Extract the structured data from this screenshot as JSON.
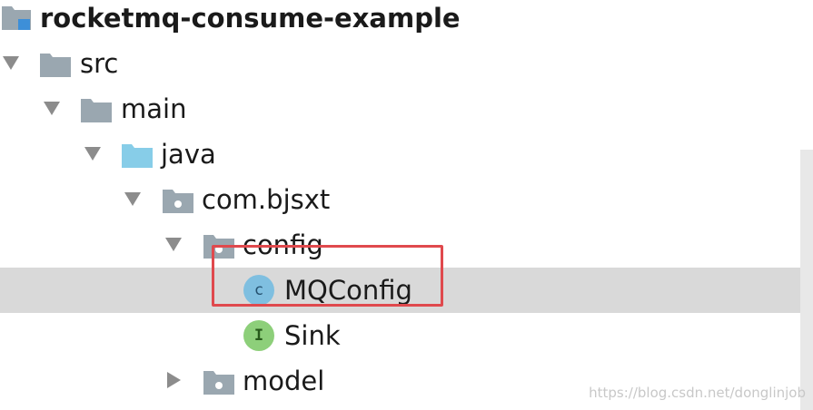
{
  "project_tree": {
    "root": {
      "label": "rocketmq-consume-example",
      "icon": "module-folder-icon"
    },
    "nodes": [
      {
        "label": "src",
        "icon": "folder-icon",
        "arrow": "expanded"
      },
      {
        "label": "main",
        "icon": "folder-icon",
        "arrow": "expanded"
      },
      {
        "label": "java",
        "icon": "source-root-folder-icon",
        "arrow": "expanded"
      },
      {
        "label": "com.bjsxt",
        "icon": "package-icon",
        "arrow": "expanded"
      },
      {
        "label": "config",
        "icon": "package-icon",
        "arrow": "expanded"
      },
      {
        "label": "MQConfig",
        "icon": "class-icon",
        "badge": "c",
        "selected": true
      },
      {
        "label": "Sink",
        "icon": "interface-icon",
        "badge": "I"
      },
      {
        "label": "model",
        "icon": "package-icon",
        "arrow": "collapsed"
      }
    ]
  },
  "watermark": "https://blog.csdn.net/donglinjob",
  "colors": {
    "selection": "#d9d9d9",
    "highlight_border": "#e0494d",
    "folder": "#9aa7b0",
    "source_folder": "#87cde8",
    "class_badge": "#7fbfe0",
    "interface_badge": "#8dcf7a"
  }
}
